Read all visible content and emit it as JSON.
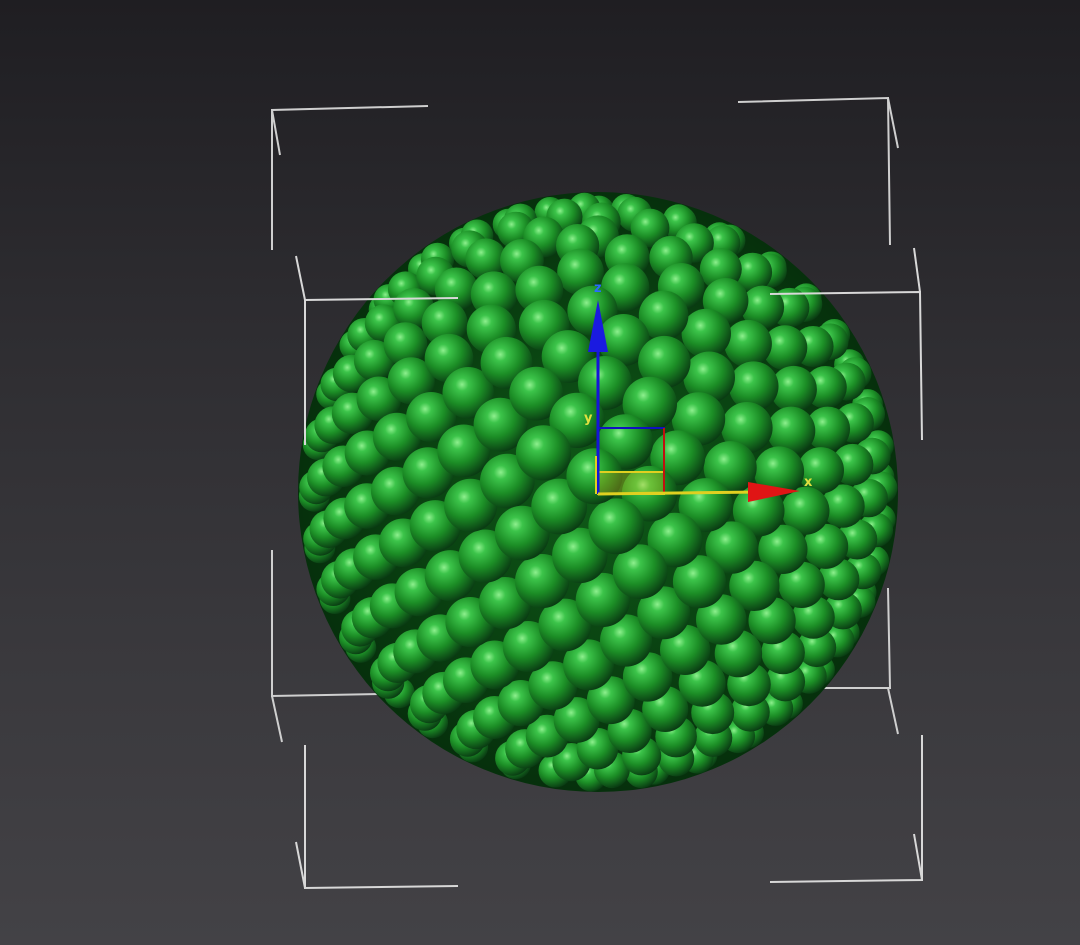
{
  "viewport": {
    "background_top": "#1f1e22",
    "background_bottom": "#434246"
  },
  "object": {
    "type": "sphere-cluster",
    "color": "#1f9a2a",
    "highlight": "#7fe07f",
    "shadow": "#0a3d10"
  },
  "selection_bracket": {
    "color": "#d8d8d8"
  },
  "gizmo": {
    "x_label": "x",
    "y_label": "y",
    "z_label": "z",
    "x_color": "#e01010",
    "y_color": "#d8d820",
    "z_color": "#1010d0"
  }
}
